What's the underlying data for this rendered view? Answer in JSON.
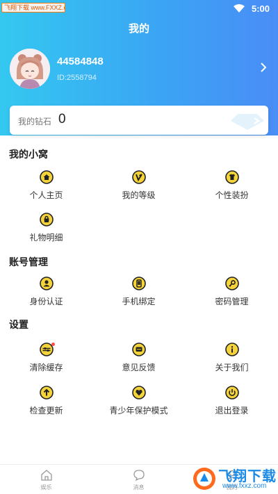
{
  "status_bar": {
    "watermark": "飞翔下载 www.FXXZ.com",
    "time": "5:00"
  },
  "header": {
    "title": "我的"
  },
  "profile": {
    "username": "44584848",
    "user_id": "ID:2558794"
  },
  "wallet": {
    "label": "我的钻石",
    "value": "0"
  },
  "sections": {
    "nest": {
      "title": "我的小窝",
      "items": [
        {
          "label": "个人主页",
          "icon": "home-icon"
        },
        {
          "label": "我的等级",
          "icon": "level-icon"
        },
        {
          "label": "个性装扮",
          "icon": "shirt-icon"
        },
        {
          "label": "礼物明细",
          "icon": "bag-icon"
        }
      ]
    },
    "account": {
      "title": "账号管理",
      "items": [
        {
          "label": "身份认证",
          "icon": "user-icon"
        },
        {
          "label": "手机绑定",
          "icon": "phone-icon"
        },
        {
          "label": "密码管理",
          "icon": "key-icon"
        }
      ]
    },
    "settings": {
      "title": "设置",
      "items": [
        {
          "label": "清除缓存",
          "icon": "clear-cache-icon"
        },
        {
          "label": "意见反馈",
          "icon": "feedback-icon"
        },
        {
          "label": "关于我们",
          "icon": "info-icon"
        },
        {
          "label": "检查更新",
          "icon": "update-icon"
        },
        {
          "label": "青少年保护模式",
          "icon": "heart-shield-icon"
        },
        {
          "label": "退出登录",
          "icon": "power-icon"
        }
      ]
    }
  },
  "tabbar": {
    "tabs": [
      {
        "label": "娱乐",
        "icon": "home-outline-icon"
      },
      {
        "label": "消息",
        "icon": "chat-bubble-icon"
      },
      {
        "label": "我的",
        "icon": "person-icon"
      }
    ]
  },
  "watermark_bottom": {
    "line1": "飞翔下载",
    "line2": "www.fxxz.com"
  },
  "colors": {
    "header_gradient_start": "#34c8f0",
    "header_gradient_end": "#4a8df6",
    "icon_fill": "#f5d33a",
    "icon_stroke": "#222222",
    "badge": "#ff4d4d"
  }
}
